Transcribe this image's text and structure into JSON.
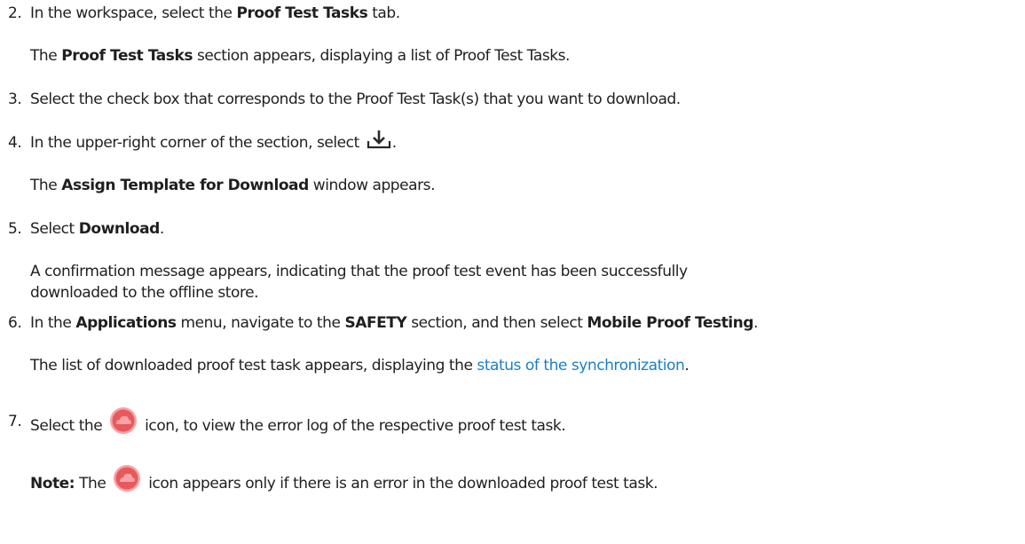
{
  "steps": [
    {
      "number": "2.",
      "pre": "In the workspace, select the ",
      "bold": "Proof Test Tasks",
      "post": " tab.",
      "result": {
        "bold": "Proof Test Tasks",
        "post": " section appears, displaying a list of Proof Test Tasks."
      }
    },
    {
      "number": "3.",
      "text": "Select the check box that corresponds to the Proof Test Task(s) that you want to download."
    },
    {
      "number": "4.",
      "pre": "In the upper-right corner of the section, select ",
      "icon": "download-icon",
      "post": ".",
      "result": {
        "pre": "The ",
        "bold": "Assign Template for Download",
        "post": " window appears."
      }
    },
    {
      "number": "5.",
      "pre": "Select ",
      "bold": "Download",
      "post": ".",
      "result": {
        "line1": "A confirmation message appears, indicating that the proof test event has been successfully",
        "line2": "downloaded to the offline store."
      }
    },
    {
      "number": "6.",
      "pre": "In the ",
      "bold1": "Applications",
      "mid1": " menu, navigate to the ",
      "bold2": "SAFETY",
      "mid2": " section, and then select ",
      "bold3": "Mobile Proof Testing",
      "post": ".",
      "result": {
        "pre": "The list of downloaded proof test task appears, displaying the ",
        "link": "status of the synchronization",
        "post": "."
      }
    },
    {
      "number": "7.",
      "pre": "Select the ",
      "icon": "error-cloud-icon",
      "post": " icon, to view the error log of the respective proof test task."
    }
  ],
  "note": {
    "label": "Note:",
    "pre": " The ",
    "icon": "error-cloud-icon",
    "post": " icon appears only if there is an error in the downloaded proof test task."
  },
  "colors": {
    "text": "#1f1f1f",
    "link": "#1a7fc7",
    "error_icon": "#e8595c",
    "error_icon_light": "#f7a3a5"
  }
}
